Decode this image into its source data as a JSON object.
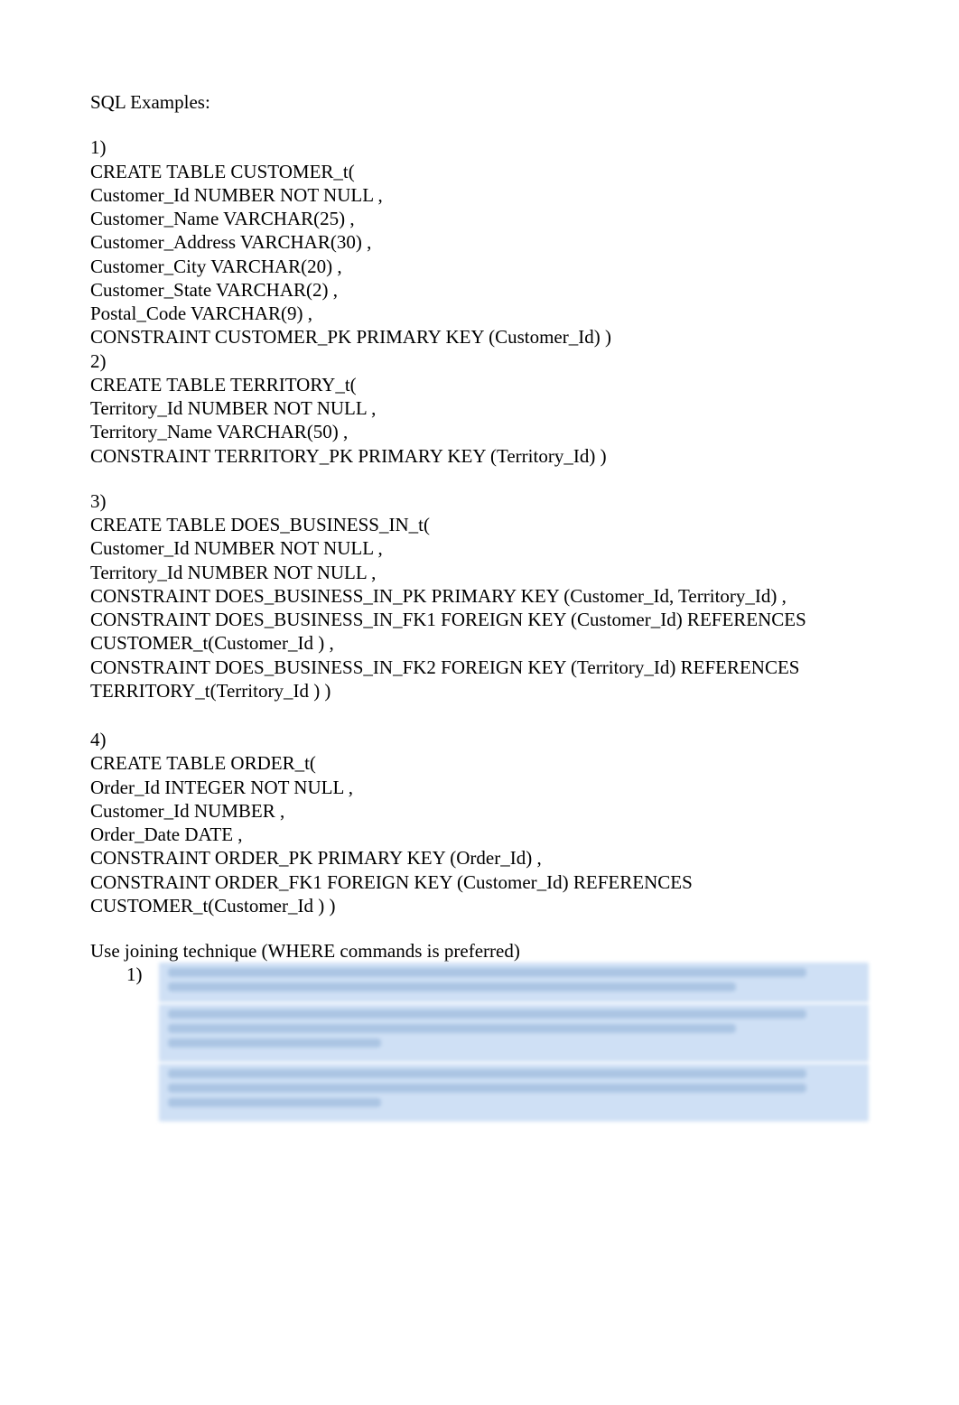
{
  "title": "SQL Examples:",
  "sections": {
    "s1": {
      "num": "1)",
      "lines": [
        "CREATE TABLE CUSTOMER_t(",
        "Customer_Id NUMBER NOT NULL ,",
        "Customer_Name VARCHAR(25) ,",
        "Customer_Address VARCHAR(30) ,",
        "Customer_City VARCHAR(20) ,",
        "Customer_State VARCHAR(2) ,",
        "Postal_Code VARCHAR(9) ,",
        "CONSTRAINT CUSTOMER_PK PRIMARY KEY (Customer_Id) )"
      ]
    },
    "s2": {
      "num": "2)",
      "lines": [
        "CREATE TABLE TERRITORY_t(",
        "Territory_Id NUMBER NOT NULL ,",
        "Territory_Name VARCHAR(50) ,",
        "CONSTRAINT TERRITORY_PK PRIMARY KEY (Territory_Id) )"
      ]
    },
    "s3": {
      "num": "3)",
      "lines": [
        "CREATE TABLE DOES_BUSINESS_IN_t(",
        "Customer_Id NUMBER NOT NULL ,",
        "Territory_Id NUMBER NOT NULL ,",
        "CONSTRAINT DOES_BUSINESS_IN_PK PRIMARY KEY (Customer_Id, Territory_Id) ,",
        "CONSTRAINT DOES_BUSINESS_IN_FK1 FOREIGN KEY (Customer_Id) REFERENCES CUSTOMER_t(Customer_Id ) ,",
        "CONSTRAINT DOES_BUSINESS_IN_FK2 FOREIGN KEY (Territory_Id) REFERENCES TERRITORY_t(Territory_Id ) )"
      ]
    },
    "s4": {
      "num": "4)",
      "lines": [
        "CREATE TABLE ORDER_t(",
        "Order_Id INTEGER NOT NULL ,",
        "Customer_Id NUMBER ,",
        "Order_Date DATE ,",
        "CONSTRAINT ORDER_PK PRIMARY KEY (Order_Id) ,",
        "CONSTRAINT ORDER_FK1 FOREIGN KEY (Customer_Id) REFERENCES CUSTOMER_t(Customer_Id ) )"
      ]
    }
  },
  "instruction": "Use joining technique (WHERE commands is preferred)",
  "list": {
    "n1": "1)"
  }
}
